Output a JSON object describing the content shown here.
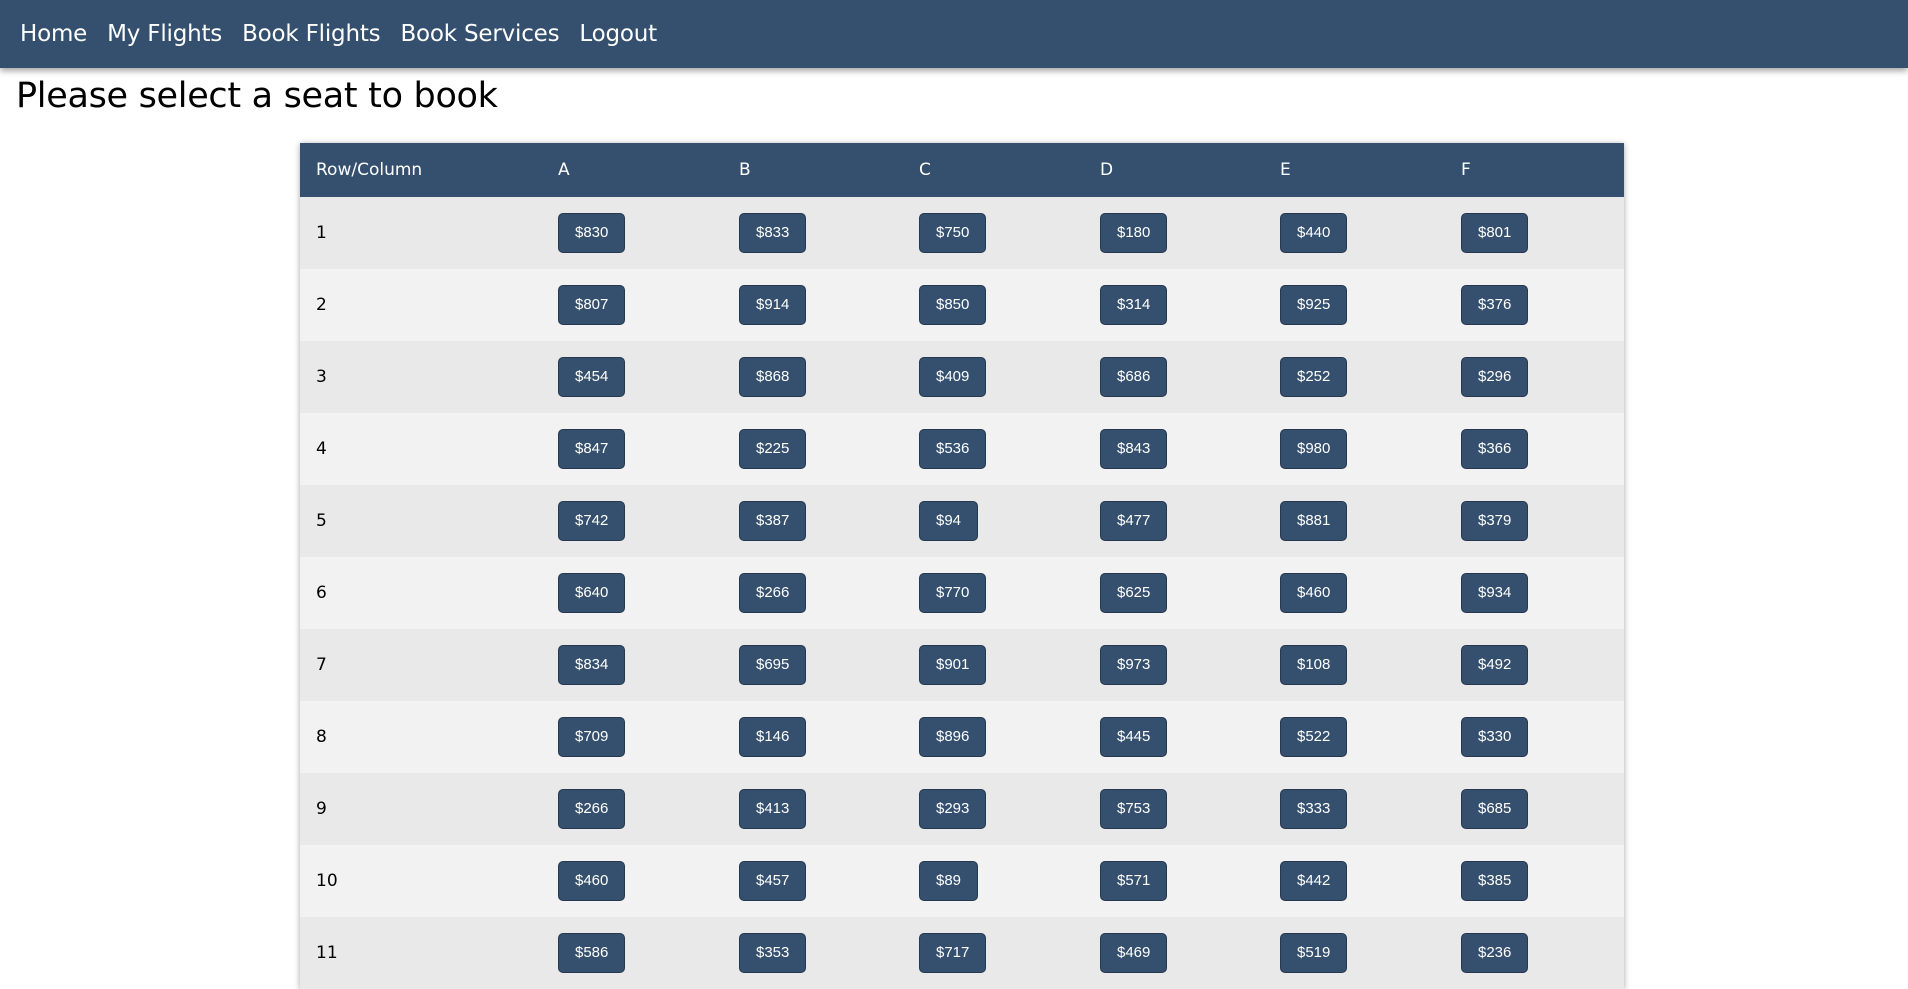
{
  "nav": {
    "items": [
      {
        "id": "home",
        "label": "Home"
      },
      {
        "id": "my-flights",
        "label": "My Flights"
      },
      {
        "id": "book-flights",
        "label": "Book Flights"
      },
      {
        "id": "book-services",
        "label": "Book Services"
      },
      {
        "id": "logout",
        "label": "Logout"
      }
    ]
  },
  "page": {
    "title": "Please select a seat to book"
  },
  "seat_table": {
    "corner_header": "Row/Column",
    "columns": [
      "A",
      "B",
      "C",
      "D",
      "E",
      "F"
    ],
    "rows": [
      {
        "row": "1",
        "prices": [
          "$830",
          "$833",
          "$750",
          "$180",
          "$440",
          "$801"
        ]
      },
      {
        "row": "2",
        "prices": [
          "$807",
          "$914",
          "$850",
          "$314",
          "$925",
          "$376"
        ]
      },
      {
        "row": "3",
        "prices": [
          "$454",
          "$868",
          "$409",
          "$686",
          "$252",
          "$296"
        ]
      },
      {
        "row": "4",
        "prices": [
          "$847",
          "$225",
          "$536",
          "$843",
          "$980",
          "$366"
        ]
      },
      {
        "row": "5",
        "prices": [
          "$742",
          "$387",
          "$94",
          "$477",
          "$881",
          "$379"
        ]
      },
      {
        "row": "6",
        "prices": [
          "$640",
          "$266",
          "$770",
          "$625",
          "$460",
          "$934"
        ]
      },
      {
        "row": "7",
        "prices": [
          "$834",
          "$695",
          "$901",
          "$973",
          "$108",
          "$492"
        ]
      },
      {
        "row": "8",
        "prices": [
          "$709",
          "$146",
          "$896",
          "$445",
          "$522",
          "$330"
        ]
      },
      {
        "row": "9",
        "prices": [
          "$266",
          "$413",
          "$293",
          "$753",
          "$333",
          "$685"
        ]
      },
      {
        "row": "10",
        "prices": [
          "$460",
          "$457",
          "$89",
          "$571",
          "$442",
          "$385"
        ]
      },
      {
        "row": "11",
        "prices": [
          "$586",
          "$353",
          "$717",
          "$469",
          "$519",
          "$236"
        ]
      }
    ]
  },
  "colors": {
    "primary": "#34506e",
    "row_odd": "#e9e9e9",
    "row_even": "#f2f2f2"
  }
}
